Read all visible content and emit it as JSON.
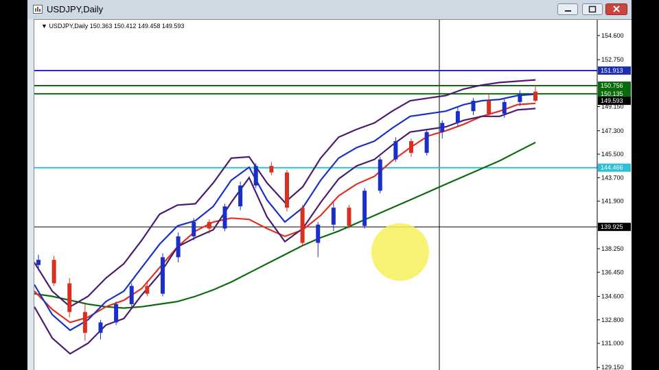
{
  "window": {
    "title": "USDJPY,Daily"
  },
  "chart": {
    "header": "USDJPY,Daily  150.363 150.412 149.458 149.593"
  },
  "chart_data": {
    "type": "line",
    "symbol": "USDJPY",
    "timeframe": "Daily",
    "ohlc": {
      "open": 150.363,
      "high": 150.412,
      "low": 149.458,
      "close": 149.593
    },
    "price_ticks": [
      "154.600",
      "152.750",
      "149.150",
      "147.300",
      "145.500",
      "143.700",
      "141.900",
      "138.250",
      "136.450",
      "134.600",
      "132.800",
      "131.000",
      "129.150"
    ],
    "ylim": [
      128.9,
      155.8
    ],
    "levels": [
      {
        "value": 151.913,
        "label": "151.913",
        "color": "#1f2fb5"
      },
      {
        "value": 150.756,
        "label": "150.756",
        "color": "#0b6a0b"
      },
      {
        "value": 150.135,
        "label": "150.135",
        "color": "#0b6a0b"
      },
      {
        "value": 149.593,
        "label": "149.593",
        "color": "#000000"
      },
      {
        "value": 144.466,
        "label": "144.466",
        "color": "#2cc0d8"
      },
      {
        "value": 139.925,
        "label": "139.925",
        "color": "#000000"
      }
    ],
    "series": [
      {
        "name": "",
        "color": "#0b6a0b",
        "values": [
          134.8,
          134.6,
          134.3,
          134.0,
          133.8,
          133.7,
          133.8,
          134.0,
          134.2,
          134.6,
          135.1,
          135.7,
          136.4,
          137.1,
          137.8,
          138.5,
          139.1,
          139.6,
          140.2,
          140.8,
          141.4,
          142.0,
          142.6,
          143.2,
          143.8,
          144.4,
          145.0,
          145.7,
          146.4
        ]
      },
      {
        "name": "",
        "color": "#e03020",
        "values": [
          135.0,
          133.6,
          132.6,
          133.0,
          133.8,
          134.3,
          135.2,
          136.8,
          138.4,
          139.6,
          140.3,
          140.6,
          140.5,
          139.8,
          139.2,
          139.7,
          140.8,
          142.3,
          143.2,
          143.8,
          145.0,
          146.0,
          146.9,
          147.3,
          147.8,
          148.4,
          148.8,
          149.3,
          149.4
        ]
      },
      {
        "name": "",
        "color": "#1a2fc8",
        "values": [
          135.5,
          133.2,
          132.0,
          132.8,
          134.2,
          135.0,
          136.8,
          138.6,
          140.0,
          140.4,
          141.5,
          143.5,
          144.5,
          142.0,
          140.3,
          141.4,
          143.5,
          145.2,
          146.0,
          146.5,
          147.5,
          148.4,
          148.6,
          148.8,
          149.3,
          149.6,
          149.7,
          150.0,
          150.1
        ]
      },
      {
        "name": "",
        "color": "#4a1a70",
        "values": [
          137.2,
          135.0,
          133.8,
          134.6,
          136.0,
          137.1,
          138.9,
          140.9,
          141.6,
          141.7,
          143.3,
          145.2,
          145.3,
          143.3,
          141.8,
          143.0,
          145.2,
          146.8,
          147.4,
          147.9,
          148.8,
          149.6,
          149.8,
          150.0,
          150.5,
          150.8,
          151.0,
          151.1,
          151.2
        ]
      },
      {
        "name": "",
        "color": "#4a1a70",
        "values": [
          133.8,
          131.4,
          130.2,
          131.0,
          132.4,
          132.9,
          134.7,
          136.3,
          138.4,
          139.1,
          139.7,
          141.8,
          143.7,
          140.7,
          138.8,
          139.8,
          141.8,
          143.6,
          144.6,
          145.1,
          146.2,
          147.2,
          147.4,
          147.6,
          148.1,
          148.4,
          148.4,
          148.9,
          149.0
        ]
      }
    ],
    "candles": [
      [
        137.0,
        137.8,
        136.6,
        137.4
      ],
      [
        137.4,
        137.7,
        135.4,
        135.6
      ],
      [
        135.6,
        136.0,
        133.0,
        133.4
      ],
      [
        133.4,
        134.0,
        131.2,
        131.8
      ],
      [
        131.8,
        132.8,
        131.3,
        132.6
      ],
      [
        132.6,
        134.2,
        132.4,
        134.0
      ],
      [
        134.0,
        135.6,
        133.8,
        135.4
      ],
      [
        135.4,
        135.8,
        134.6,
        134.8
      ],
      [
        134.8,
        137.9,
        134.6,
        137.6
      ],
      [
        137.6,
        139.5,
        137.2,
        139.2
      ],
      [
        139.2,
        140.6,
        138.9,
        140.3
      ],
      [
        140.3,
        140.5,
        139.4,
        139.8
      ],
      [
        139.8,
        141.7,
        139.6,
        141.5
      ],
      [
        141.5,
        143.4,
        141.2,
        143.1
      ],
      [
        143.1,
        144.8,
        142.9,
        144.6
      ],
      [
        144.6,
        144.9,
        143.9,
        144.1
      ],
      [
        144.1,
        144.3,
        141.1,
        141.4
      ],
      [
        141.4,
        141.6,
        138.4,
        138.7
      ],
      [
        138.7,
        140.3,
        137.6,
        140.1
      ],
      [
        140.1,
        141.8,
        139.6,
        141.4
      ],
      [
        141.4,
        141.6,
        139.8,
        140.0
      ],
      [
        140.0,
        142.9,
        139.8,
        142.7
      ],
      [
        142.7,
        145.3,
        142.5,
        145.1
      ],
      [
        145.1,
        146.8,
        144.9,
        146.5
      ],
      [
        146.5,
        146.7,
        145.3,
        145.6
      ],
      [
        145.6,
        147.4,
        145.4,
        147.2
      ],
      [
        147.2,
        148.1,
        146.7,
        147.9
      ],
      [
        147.9,
        149.1,
        147.6,
        148.8
      ],
      [
        148.8,
        149.8,
        148.5,
        149.6
      ],
      [
        149.6,
        150.1,
        148.4,
        148.6
      ],
      [
        148.6,
        149.7,
        148.3,
        149.5
      ],
      [
        149.5,
        150.4,
        149.2,
        150.1
      ],
      [
        150.3,
        150.8,
        149.5,
        149.6
      ]
    ]
  }
}
